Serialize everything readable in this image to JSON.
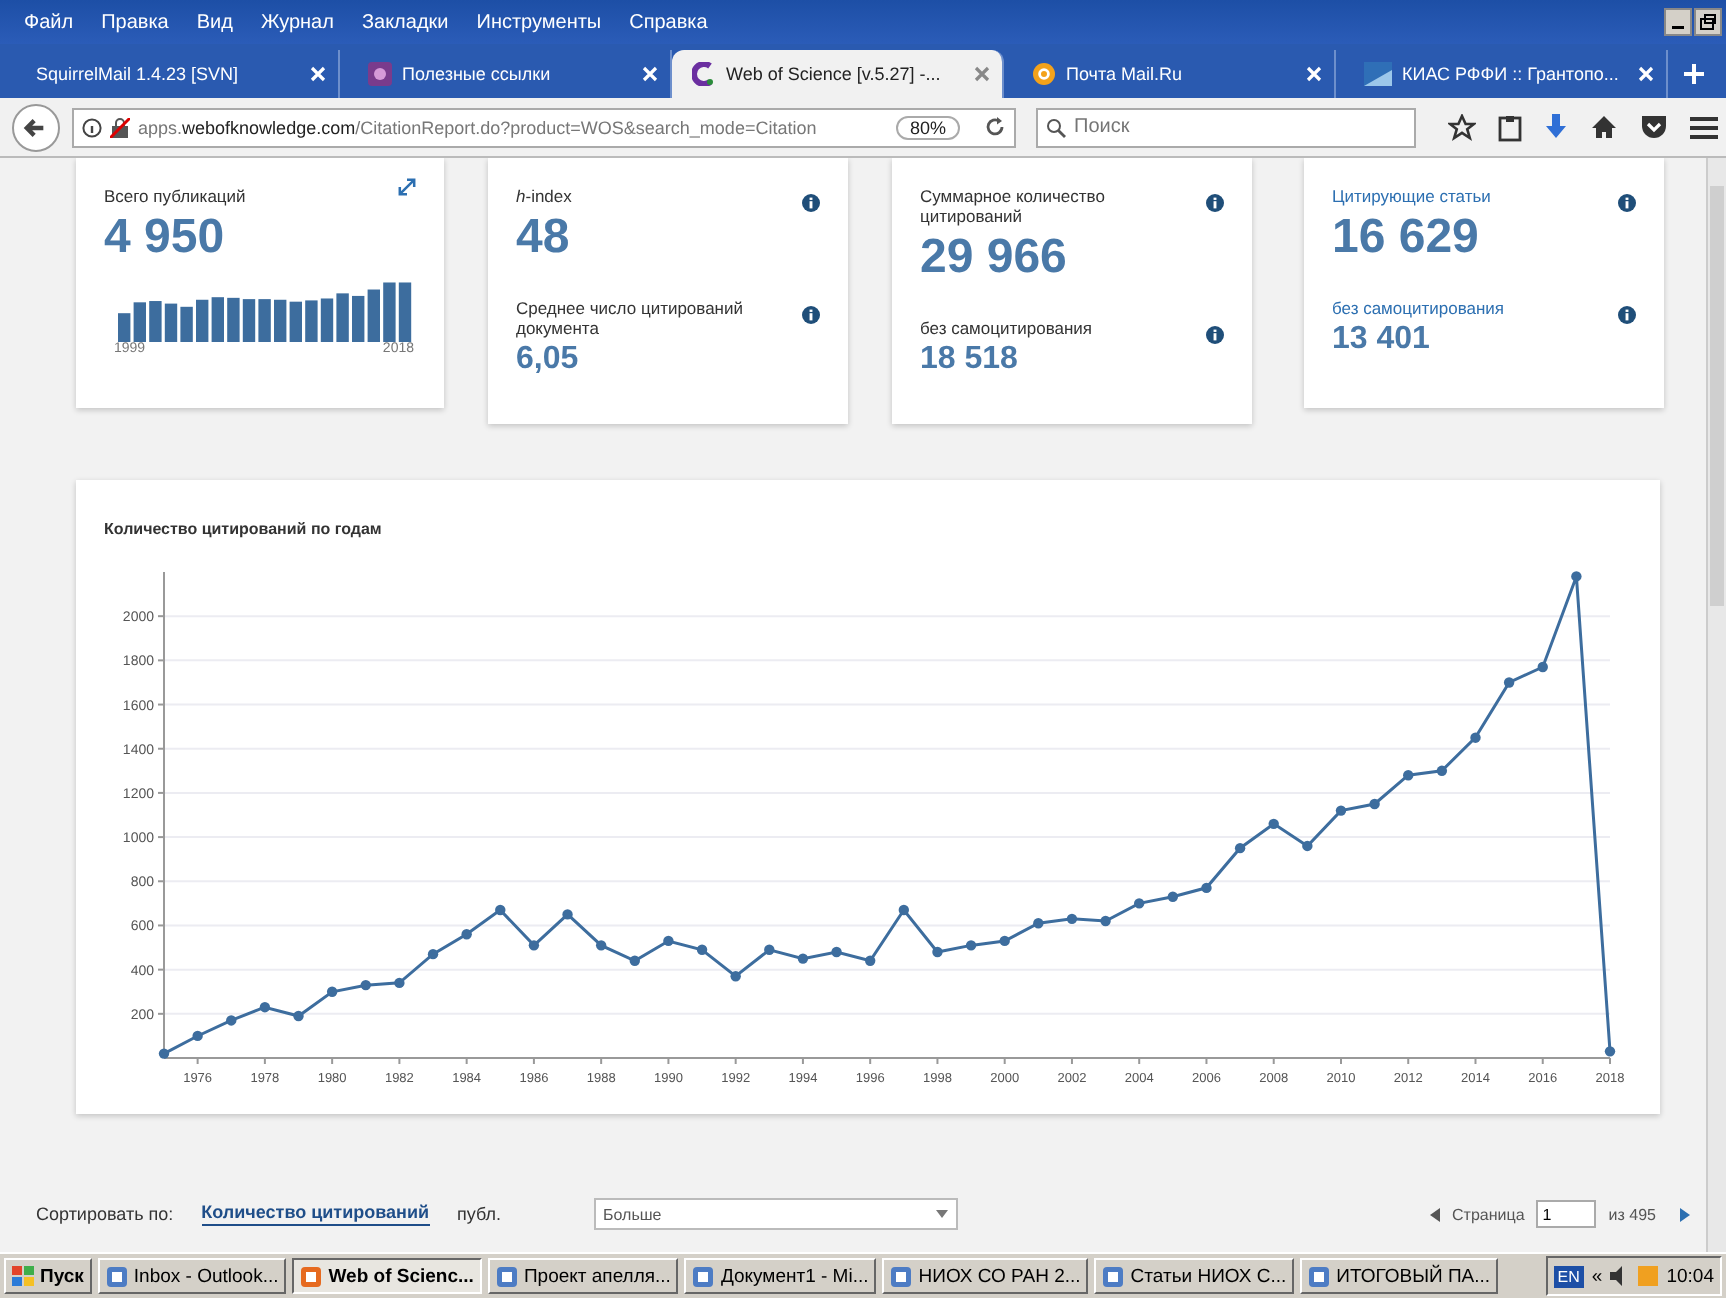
{
  "menu": [
    "Файл",
    "Правка",
    "Вид",
    "Журнал",
    "Закладки",
    "Инструменты",
    "Справка"
  ],
  "tabs": [
    {
      "label": "SquirrelMail 1.4.23 [SVN]",
      "selected": false
    },
    {
      "label": "Полезные ссылки",
      "selected": false
    },
    {
      "label": "Web of Science [v.5.27] -...",
      "selected": true
    },
    {
      "label": "Почта Mail.Ru",
      "selected": false
    },
    {
      "label": "КИАС РФФИ :: Грантопо...",
      "selected": false
    }
  ],
  "address": {
    "url": "apps.**webofknowledge.com**/CitationReport.do?product=WOS&search_mode=Citation",
    "zoom": "80%"
  },
  "search": {
    "placeholder": "Поиск"
  },
  "cards": [
    {
      "kind": "publications",
      "metrics": [
        {
          "label": "Всего публикаций",
          "value": "4 950",
          "link": false
        }
      ],
      "axis": [
        "1999",
        "2018"
      ]
    },
    {
      "kind": "metrics",
      "metrics": [
        {
          "label": "*h*-index",
          "value": "48",
          "link": false
        },
        {
          "label": "Среднее число цитирований документа",
          "value": "6,05",
          "link": false
        }
      ]
    },
    {
      "kind": "metrics",
      "metrics": [
        {
          "label": "Суммарное количество цитирований",
          "value": "29 966",
          "link": false
        },
        {
          "label": "без самоцитирования",
          "value": "18 518",
          "link": false
        }
      ]
    },
    {
      "kind": "metrics",
      "metrics": [
        {
          "label": "Цитирующие статьи",
          "value": "16 629",
          "link": true
        },
        {
          "label": "без самоцитирования",
          "value": "13 401",
          "link": true
        }
      ]
    }
  ],
  "chart": {
    "title": "Количество цитирований по годам",
    "chart_data": {
      "type": "line",
      "grid": true,
      "x": [
        1975,
        1976,
        1977,
        1978,
        1979,
        1980,
        1981,
        1982,
        1983,
        1984,
        1985,
        1986,
        1987,
        1988,
        1989,
        1990,
        1991,
        1992,
        1993,
        1994,
        1995,
        1996,
        1997,
        1998,
        1999,
        2000,
        2001,
        2002,
        2003,
        2004,
        2005,
        2006,
        2007,
        2008,
        2009,
        2010,
        2011,
        2012,
        2013,
        2014,
        2015,
        2016,
        2017,
        2018
      ],
      "series": [
        {
          "color": "#3d6d9e",
          "marker": "circle",
          "values": [
            20,
            100,
            170,
            230,
            190,
            300,
            330,
            340,
            470,
            560,
            670,
            510,
            650,
            510,
            440,
            530,
            490,
            370,
            490,
            450,
            480,
            440,
            670,
            480,
            510,
            530,
            610,
            630,
            620,
            700,
            730,
            770,
            950,
            1060,
            960,
            1120,
            1150,
            1280,
            1300,
            1450,
            1700,
            1770,
            2180,
            30
          ]
        }
      ],
      "xlim": [
        1975,
        2018
      ],
      "ylim": [
        0,
        2200
      ],
      "xticks": [
        1976,
        1978,
        1980,
        1982,
        1984,
        1986,
        1988,
        1990,
        1992,
        1994,
        1996,
        1998,
        2000,
        2002,
        2004,
        2006,
        2008,
        2010,
        2012,
        2014,
        2016,
        2018
      ],
      "yticks": [
        200,
        400,
        600,
        800,
        1000,
        1200,
        1400,
        1600,
        1800,
        2000
      ]
    }
  },
  "sort": {
    "label": "Сортировать по:",
    "options": [
      {
        "label": "Количество цитирований",
        "selected": true
      },
      {
        "label": "публ.",
        "selected": false
      }
    ],
    "dropdown": "Больше"
  },
  "pager": {
    "label": "Страница",
    "value": "1",
    "total": "из 495"
  },
  "taskbar": {
    "start": "Пуск",
    "items": [
      {
        "label": "Inbox - Outlook...",
        "selected": false
      },
      {
        "label": "Web of Scienc...",
        "selected": true
      },
      {
        "label": "Проект апелля...",
        "selected": false
      },
      {
        "label": "Документ1 - Mi...",
        "selected": false
      },
      {
        "label": "НИОХ СО РАН 2...",
        "selected": false
      },
      {
        "label": "Статьи НИОХ С...",
        "selected": false
      },
      {
        "label": "ИТОГОВЫЙ ПА...",
        "selected": false
      }
    ],
    "lang": "EN",
    "chevron": "«",
    "time": "10:04"
  }
}
